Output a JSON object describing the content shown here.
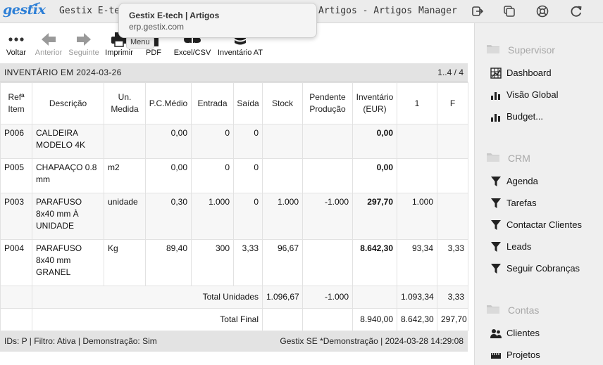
{
  "header": {
    "logo_text": "gestix",
    "app_title": "Gestix E-tech",
    "page_title": "Artigos - Artigos",
    "user": "Manager",
    "icons": [
      "logout-icon",
      "window-icon",
      "help-lifebuoy-icon",
      "refresh-icon"
    ]
  },
  "tooltip": {
    "title": "Gestix E-tech | Artigos",
    "url": "erp.gestix.com"
  },
  "toolbar": {
    "back": "Voltar",
    "previous": "Anterior",
    "next": "Seguinte",
    "print": "Imprimir",
    "pdf": "PDF",
    "excel": "Excel/CSV",
    "inventory_at": "Inventário AT",
    "menu_chip": "Menu"
  },
  "report": {
    "title": "INVENTÁRIO EM 2024-03-26",
    "pages": "1..4 / 4",
    "columns": {
      "ref": "Refª Item",
      "desc": "Descrição",
      "unit": "Un. Medida",
      "pcm": "P.C.Médio",
      "in": "Entrada",
      "out": "Saída",
      "stock": "Stock",
      "pending": "Pendente Produção",
      "inv": "Inventário (EUR)",
      "c1": "1",
      "cf": "F"
    },
    "rows": [
      {
        "ref": "P006",
        "desc": "CALDEIRA MODELO 4K",
        "unit": "",
        "pcm": "0,00",
        "in": "0",
        "out": "0",
        "stock": "",
        "pending": "",
        "inv": "0,00",
        "c1": "",
        "cf": ""
      },
      {
        "ref": "P005",
        "desc": "CHAPAAÇO 0.8 mm",
        "unit": "m2",
        "pcm": "0,00",
        "in": "0",
        "out": "0",
        "stock": "",
        "pending": "",
        "inv": "0,00",
        "c1": "",
        "cf": ""
      },
      {
        "ref": "P003",
        "desc": "PARAFUSO 8x40 mm À UNIDADE",
        "unit": "unidade",
        "pcm": "0,30",
        "in": "1.000",
        "out": "0",
        "stock": "1.000",
        "pending": "-1.000",
        "inv": "297,70",
        "c1": "1.000",
        "cf": ""
      },
      {
        "ref": "P004",
        "desc": "PARAFUSO 8x40 mm GRANEL",
        "unit": "Kg",
        "pcm": "89,40",
        "in": "300",
        "out": "3,33",
        "stock": "96,67",
        "pending": "",
        "inv": "8.642,30",
        "c1": "93,34",
        "cf": "3,33"
      }
    ],
    "total_units": {
      "label": "Total Unidades",
      "stock": "1.096,67",
      "pending": "-1.000",
      "c1": "1.093,34",
      "cf": "3,33"
    },
    "total_final": {
      "label": "Total Final",
      "inv": "8.940,00",
      "c1": "8.642,30",
      "cf": "297,70"
    }
  },
  "footer": {
    "left": "IDs: P | Filtro: Ativa | Demonstração: Sim",
    "right": "Gestix SE *Demonstração | 2024-03-28 14:29:08"
  },
  "sidebar": {
    "supervisor": {
      "title": "Supervisor",
      "items": [
        "Dashboard",
        "Visão Global",
        "Budget..."
      ]
    },
    "crm": {
      "title": "CRM",
      "items": [
        "Agenda",
        "Tarefas",
        "Contactar Clientes",
        "Leads",
        "Seguir Cobranças"
      ]
    },
    "contas": {
      "title": "Contas",
      "items": [
        "Clientes",
        "Projetos"
      ]
    }
  },
  "colors": {
    "brand": "#2d7fd6",
    "panel": "#efefef",
    "header": "#ececec"
  }
}
